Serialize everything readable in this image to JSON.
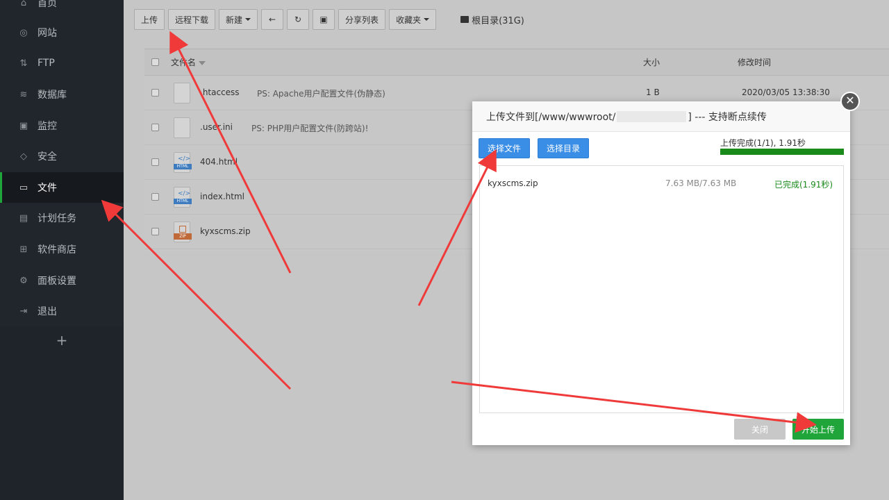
{
  "sidebar": {
    "items": [
      {
        "label": "首页",
        "icon": "home-icon"
      },
      {
        "label": "网站",
        "icon": "globe-icon"
      },
      {
        "label": "FTP",
        "icon": "ftp-icon"
      },
      {
        "label": "数据库",
        "icon": "database-icon"
      },
      {
        "label": "监控",
        "icon": "monitor-icon"
      },
      {
        "label": "安全",
        "icon": "shield-icon"
      },
      {
        "label": "文件",
        "icon": "folder-icon"
      },
      {
        "label": "计划任务",
        "icon": "calendar-icon"
      },
      {
        "label": "软件商店",
        "icon": "apps-icon"
      },
      {
        "label": "面板设置",
        "icon": "gear-icon"
      },
      {
        "label": "退出",
        "icon": "logout-icon"
      }
    ],
    "active_index": 6,
    "add_label": "+"
  },
  "toolbar": {
    "upload": "上传",
    "remote_download": "远程下载",
    "new": "新建",
    "share_list": "分享列表",
    "favorites": "收藏夹",
    "root": "根目录(31G)"
  },
  "table": {
    "headers": {
      "name": "文件名",
      "size": "大小",
      "mtime": "修改时间"
    },
    "rows": [
      {
        "name": ".htaccess",
        "ps": "PS: Apache用户配置文件(伪静态)",
        "size": "1 B",
        "mtime": "2020/03/05 13:38:30",
        "type": "file"
      },
      {
        "name": ".user.ini",
        "ps": "PS: PHP用户配置文件(防跨站)!",
        "size": "",
        "mtime": "",
        "type": "file"
      },
      {
        "name": "404.html",
        "ps": "",
        "size": "",
        "mtime": "",
        "type": "html"
      },
      {
        "name": "index.html",
        "ps": "",
        "size": "",
        "mtime": "",
        "type": "html"
      },
      {
        "name": "kyxscms.zip",
        "ps": "",
        "size": "",
        "mtime": "",
        "type": "zip"
      }
    ]
  },
  "dialog": {
    "title_prefix": "上传文件到[/www/wwwroot/",
    "title_suffix": "] --- 支持断点续传",
    "select_file": "选择文件",
    "select_dir": "选择目录",
    "progress_text": "上传完成(1/1), 1.91秒",
    "progress": 1.0,
    "file": {
      "name": "kyxscms.zip",
      "size": "7.63 MB/7.63 MB",
      "status": "已完成(1.91秒)"
    },
    "close_label": "关闭",
    "start_label": "开始上传"
  },
  "colors": {
    "accent_green": "#20a53a",
    "button_blue": "#3a8ee6",
    "arrow_red": "#f03a3a"
  }
}
